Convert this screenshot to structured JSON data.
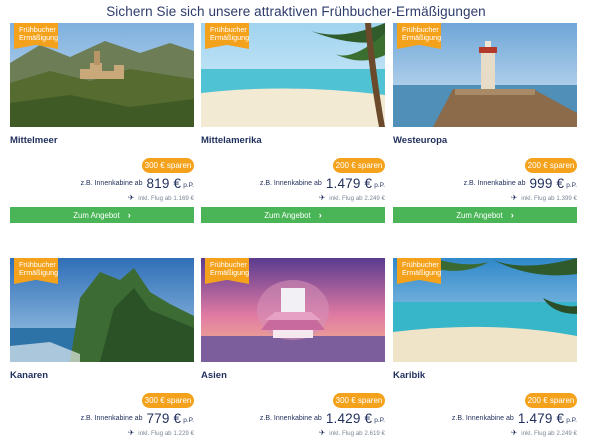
{
  "headline": "Sichern Sie sich unsere attraktiven Frühbucher-Ermäßigungen",
  "badge_line1": "Frühbucher",
  "badge_line2": "Ermäßigung",
  "price_label": "z.B. Innenkabine ab",
  "per_person": "p.P.",
  "cta_label": "Zum Angebot",
  "icons": {
    "flight": "airplane-icon",
    "chevron": "chevron-right-icon"
  },
  "colors": {
    "badge": "#f4a21c",
    "button": "#49b557",
    "text": "#1f2e5c"
  },
  "offers": [
    {
      "destination": "Mittelmeer",
      "savings": "300 € sparen",
      "price": "819 €",
      "flight": "inkl. Flug ab 1.169 €"
    },
    {
      "destination": "Mittelamerika",
      "savings": "200 € sparen",
      "price": "1.479 €",
      "flight": "inkl. Flug ab 2.249 €"
    },
    {
      "destination": "Westeuropa",
      "savings": "200 € sparen",
      "price": "999 €",
      "flight": "inkl. Flug ab 1.399 €"
    },
    {
      "destination": "Kanaren",
      "savings": "300 € sparen",
      "price": "779 €",
      "flight": "inkl. Flug ab 1.229 €"
    },
    {
      "destination": "Asien",
      "savings": "300 € sparen",
      "price": "1.429 €",
      "flight": "inkl. Flug ab 2.619 €"
    },
    {
      "destination": "Karibik",
      "savings": "200 € sparen",
      "price": "1.479 €",
      "flight": "inkl. Flug ab 2.249 €"
    }
  ]
}
